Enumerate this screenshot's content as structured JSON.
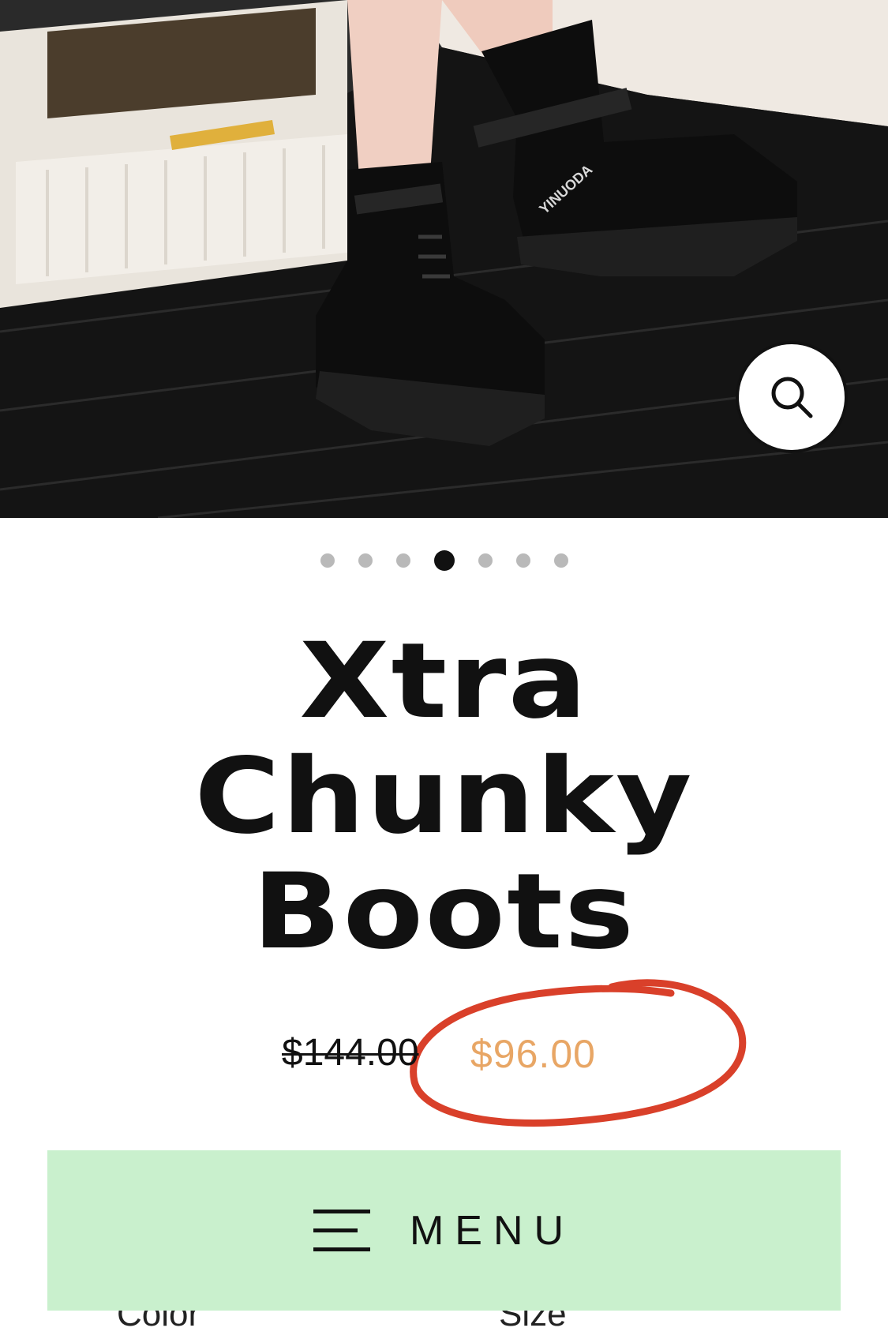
{
  "product": {
    "title_lines": [
      "Xtra",
      "Chunky",
      "Boots"
    ],
    "original_price": "$144.00",
    "sale_price": "$96.00",
    "gallery": {
      "slide_count": 7,
      "active_slide": 4,
      "brand_text_on_boot": "YINUODA"
    },
    "option_labels": [
      "Color",
      "Size"
    ]
  },
  "menu": {
    "label": "MENU"
  },
  "icons": {
    "zoom": "search-icon",
    "menu": "hamburger-icon"
  },
  "colors": {
    "menu_background": "#c9f0cd",
    "sale_price": "#e8a665",
    "annotation_circle": "#d9402a",
    "title_text": "#111111"
  }
}
